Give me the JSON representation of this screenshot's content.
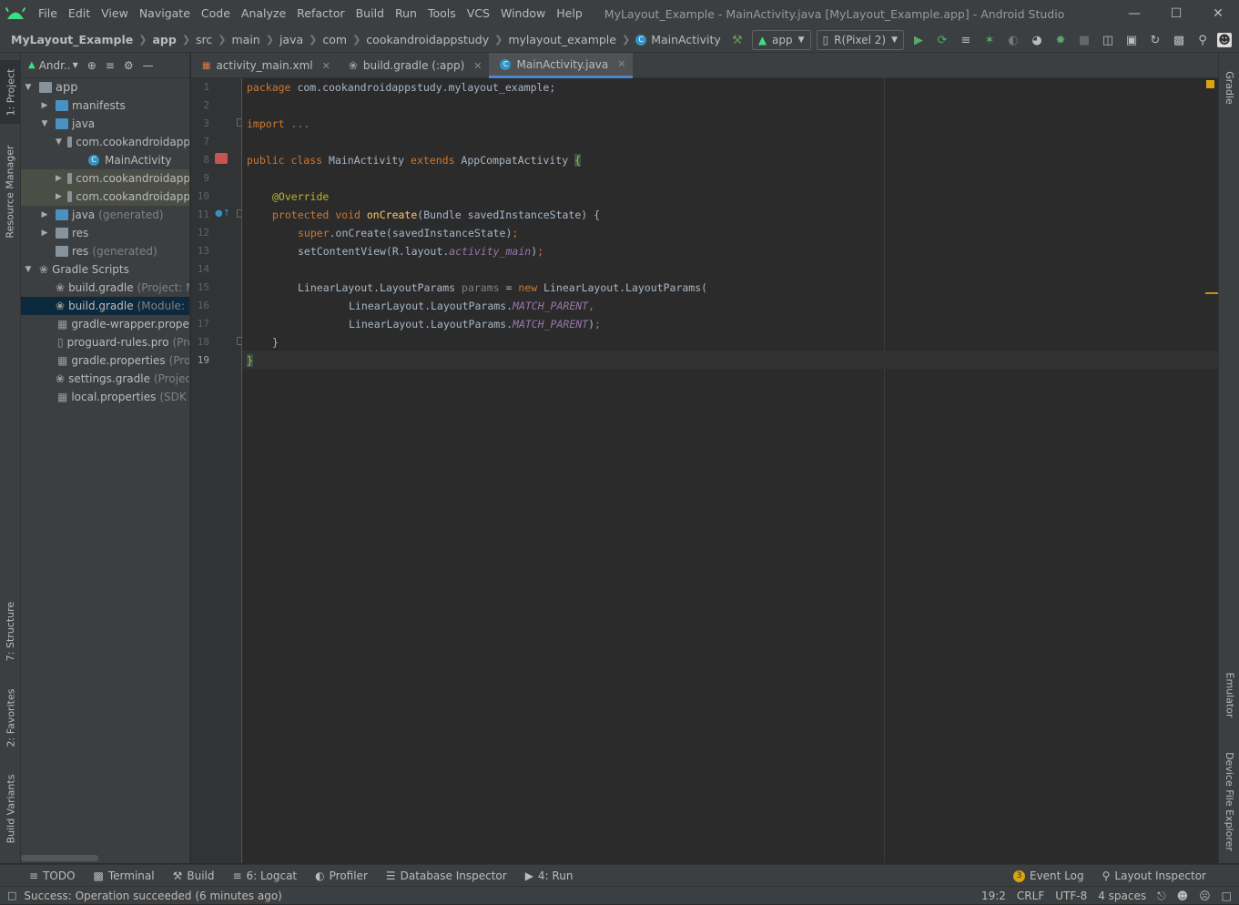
{
  "window": {
    "title": "MyLayout_Example - MainActivity.java [MyLayout_Example.app] - Android Studio",
    "menu": [
      "File",
      "Edit",
      "View",
      "Navigate",
      "Code",
      "Analyze",
      "Refactor",
      "Build",
      "Run",
      "Tools",
      "VCS",
      "Window",
      "Help"
    ]
  },
  "breadcrumb": [
    "MyLayout_Example",
    "app",
    "src",
    "main",
    "java",
    "com",
    "cookandroidappstudy",
    "mylayout_example",
    "MainActivity"
  ],
  "toolbar": {
    "config": "app",
    "device": "R(Pixel 2)"
  },
  "project": {
    "view": "Andr..",
    "tree": [
      {
        "label": "app",
        "dim": ""
      },
      {
        "label": "manifests",
        "dim": ""
      },
      {
        "label": "java",
        "dim": ""
      },
      {
        "label": "com.cookandroidapp",
        "dim": ""
      },
      {
        "label": "MainActivity",
        "dim": ""
      },
      {
        "label": "com.cookandroidapp",
        "dim": ""
      },
      {
        "label": "com.cookandroidapp",
        "dim": ""
      },
      {
        "label": "java",
        "dim": "(generated)"
      },
      {
        "label": "res",
        "dim": ""
      },
      {
        "label": "res",
        "dim": "(generated)"
      },
      {
        "label": "Gradle Scripts",
        "dim": ""
      },
      {
        "label": "build.gradle",
        "dim": "(Project: My"
      },
      {
        "label": "build.gradle",
        "dim": "(Module: M"
      },
      {
        "label": "gradle-wrapper.propertie",
        "dim": ""
      },
      {
        "label": "proguard-rules.pro",
        "dim": "(Pro"
      },
      {
        "label": "gradle.properties",
        "dim": "(Projec"
      },
      {
        "label": "settings.gradle",
        "dim": "(Project S"
      },
      {
        "label": "local.properties",
        "dim": "(SDK Lo"
      }
    ]
  },
  "tabs": [
    {
      "label": "activity_main.xml"
    },
    {
      "label": "build.gradle (:app)"
    },
    {
      "label": "MainActivity.java"
    }
  ],
  "code": {
    "line_numbers": [
      "1",
      "2",
      "3",
      "7",
      "8",
      "9",
      "10",
      "11",
      "12",
      "13",
      "14",
      "15",
      "16",
      "17",
      "18",
      "19"
    ],
    "l1_kw": "package",
    "l1_rest": " com.cookandroidappstudy.mylayout_example;",
    "l3_kw": "import",
    "l3_rest": " ...",
    "l7_a": "public class",
    "l7_b": " MainActivity ",
    "l7_c": "extends",
    "l7_d": " AppCompatActivity ",
    "l7_e": "{",
    "l10": "@Override",
    "l11_a": "protected void",
    "l11_b": "onCreate",
    "l11_c": "(Bundle savedInstanceState) {",
    "l12_a": "super",
    "l12_b": ".onCreate(savedInstanceState)",
    "l12_c": ";",
    "l13_a": "setContentView(R.layout.",
    "l13_b": "activity_main",
    "l13_c": ")",
    "l13_d": ";",
    "l15_a": "LinearLayout.LayoutParams ",
    "l15_b": "params",
    "l15_c": " = ",
    "l15_d": "new",
    "l15_e": " LinearLayout.LayoutParams(",
    "l16_a": "LinearLayout.LayoutParams.",
    "l16_b": "MATCH_PARENT",
    "l16_c": ",",
    "l17_a": "LinearLayout.LayoutParams.",
    "l17_b": "MATCH_PARENT",
    "l17_c": ")",
    "l17_d": ";",
    "l18": "}",
    "l19": "}"
  },
  "left_tools": [
    "1: Project",
    "Resource Manager",
    "7: Structure",
    "2: Favorites",
    "Build Variants"
  ],
  "right_tools": [
    "Gradle",
    "Emulator",
    "Device File Explorer"
  ],
  "bottom_tools": [
    "TODO",
    "Terminal",
    "Build",
    "6: Logcat",
    "Profiler",
    "Database Inspector",
    "4: Run"
  ],
  "bottom_right_tools": {
    "event_log": "Event Log",
    "event_count": "3",
    "layout_inspector": "Layout Inspector"
  },
  "status": {
    "message": "Success: Operation succeeded (6 minutes ago)",
    "position": "19:2",
    "line_sep": "CRLF",
    "encoding": "UTF-8",
    "indent": "4 spaces"
  }
}
